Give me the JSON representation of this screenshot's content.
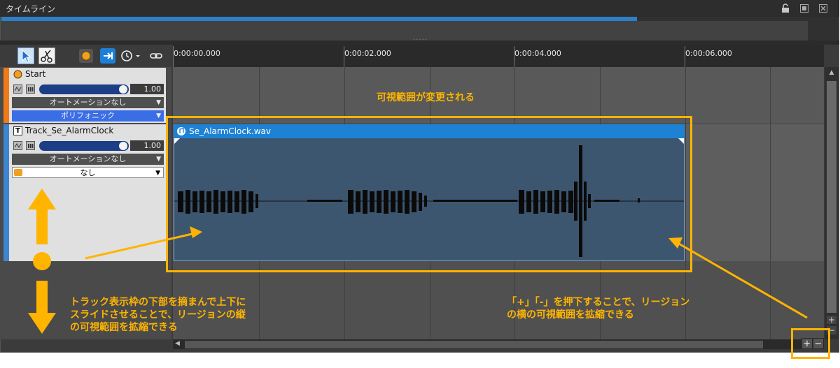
{
  "window": {
    "title": "タイムライン"
  },
  "ruler": {
    "ticks": [
      "0:00:00.000",
      "0:00:02.000",
      "0:00:04.000",
      "0:00:06.000"
    ]
  },
  "tracks": [
    {
      "name": "Start",
      "volume": "1.00",
      "volume_level": 0.97,
      "automation": "オートメーションなし",
      "mode": "ポリフォニック",
      "color": "#ef7a17"
    },
    {
      "name": "Track_Se_AlarmClock",
      "volume": "1.00",
      "volume_level": 0.97,
      "automation": "オートメーションなし",
      "mode": "なし",
      "color": "#3d86cf"
    }
  ],
  "region": {
    "name": "Se_AlarmClock.wav",
    "color": "#1e82d4"
  },
  "zoom": {
    "plus": "+",
    "minus": "−"
  },
  "annotations": {
    "visible_range": "可視範囲が変更される",
    "vertical_1": "トラック表示枠の下部を摘まんで上下に",
    "vertical_2": "スライドさせることで、リージョンの縦",
    "vertical_3": "の可視範囲を拡縮できる",
    "horizontal_1": "「+」「-」を押下することで、リージョン",
    "horizontal_2": "の横の可視範囲を拡縮できる",
    "color": "#ffb400"
  },
  "icons": [
    "lock-icon",
    "float-window-icon",
    "close-icon",
    "select-tool-icon",
    "scissors-tool-icon",
    "record-icon",
    "follow-icon",
    "clock-icon",
    "link-icon",
    "mute-icon",
    "solo-icon",
    "track-type-icon",
    "audio-file-icon"
  ]
}
